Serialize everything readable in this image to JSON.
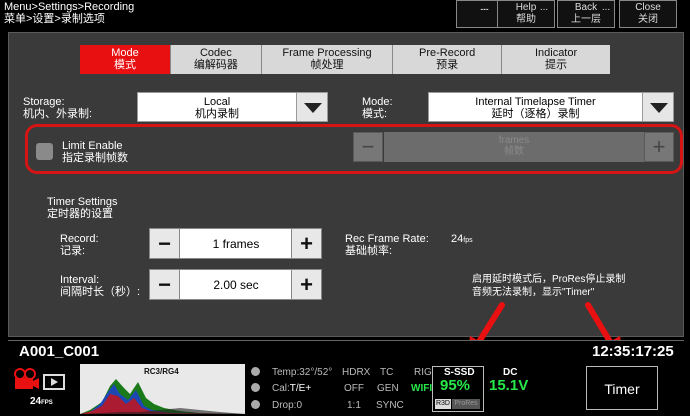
{
  "header": {
    "breadcrumb_en": "Menu>Settings>Recording",
    "breadcrumb_cn": "菜单>设置>录制选项",
    "buttons": [
      {
        "dots": "...",
        "label": "",
        "label_cn": ""
      },
      {
        "dots": "...",
        "label": "Help",
        "label_cn": "帮助"
      },
      {
        "dots": "...",
        "label": "Back",
        "label_cn": "上一层"
      },
      {
        "dots": "...",
        "label": "Close",
        "label_cn": "关闭"
      }
    ]
  },
  "tabs": [
    {
      "label": "Mode",
      "label_cn": "模式",
      "active": true
    },
    {
      "label": "Codec",
      "label_cn": "编解码器",
      "active": false
    },
    {
      "label": "Frame Processing",
      "label_cn": "帧处理",
      "active": false
    },
    {
      "label": "Pre-Record",
      "label_cn": "预录",
      "active": false
    },
    {
      "label": "Indicator",
      "label_cn": "提示",
      "active": false
    }
  ],
  "storage": {
    "label": "Storage:",
    "label_cn": "机内、外录制:",
    "value": "Local",
    "value_cn": "机内录制"
  },
  "mode": {
    "label": "Mode:",
    "label_cn": "模式:",
    "value": "Internal Timelapse Timer",
    "value_cn": "延时（逐格）录制"
  },
  "limit": {
    "label": "Limit Enable",
    "label_cn": "指定录制帧数",
    "checked": false,
    "placeholder": "frames",
    "placeholder_cn": "帧数",
    "minus": "−",
    "plus": "+"
  },
  "timer_settings": {
    "title": "Timer Settings",
    "title_cn": "定时器的设置",
    "record": {
      "label": "Record:",
      "label_cn": "记录:",
      "value": "1 frames",
      "minus": "−",
      "plus": "+"
    },
    "interval": {
      "label": "Interval:",
      "label_cn": "间隔时长（秒）:",
      "value": "2.00 sec",
      "minus": "−",
      "plus": "+"
    },
    "rate": {
      "label": "Rec Frame Rate:",
      "label_cn": "基础帧率:",
      "value": "24",
      "unit": "fps"
    }
  },
  "annotation": {
    "line1": "启用延时模式后，ProRes停止录制",
    "line2": "音频无法录制，显示\"Timer\""
  },
  "clip": {
    "name": "A001_C001",
    "timecode": "12:35:17:25"
  },
  "status": {
    "fps": "24",
    "fps_unit": "FPS",
    "histo_label": "RC3/RG4",
    "temp": "Temp:32°/52°",
    "cal": "Cal:",
    "cal_value": "T/E+",
    "drop": "Drop:0",
    "hdrx": "HDRX",
    "off": "OFF",
    "ratio": "1:1",
    "tc": "TC",
    "gen": "GEN",
    "sync": "SYNC",
    "rig": "RIG",
    "wifi": "WIFI",
    "media": "S-SSD",
    "media_pct": "95%",
    "r3d": "R3D",
    "prores": "ProRes",
    "dc": "DC",
    "voltage": "15.1V",
    "timer": "Timer"
  },
  "colors": {
    "accent": "#e81010",
    "green": "#27e84a",
    "annotation_red": "#d61414"
  }
}
